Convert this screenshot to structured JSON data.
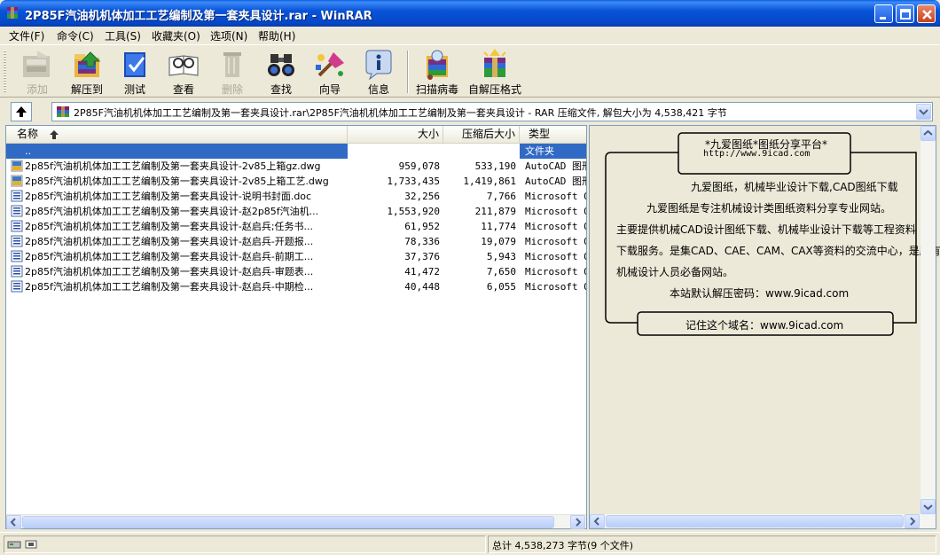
{
  "window": {
    "title": "2P85F汽油机机体加工工艺编制及第一套夹具设计.rar - WinRAR"
  },
  "menu": [
    "文件(F)",
    "命令(C)",
    "工具(S)",
    "收藏夹(O)",
    "选项(N)",
    "帮助(H)"
  ],
  "toolbar": {
    "add": "添加",
    "extract": "解压到",
    "test": "测试",
    "view": "查看",
    "delete": "删除",
    "find": "查找",
    "wizard": "向导",
    "info": "信息",
    "scan": "扫描病毒",
    "sfx": "自解压格式"
  },
  "address": {
    "path": "2P85F汽油机机体加工工艺编制及第一套夹具设计.rar\\2P85F汽油机机体加工工艺编制及第一套夹具设计 - RAR 压缩文件, 解包大小为 4,538,421 字节"
  },
  "columns": {
    "name": "名称",
    "size": "大小",
    "packed": "压缩后大小",
    "type": "类型"
  },
  "files": [
    {
      "name": "..",
      "size": "",
      "packed": "",
      "type": "文件夹",
      "icon": "folder-icon"
    },
    {
      "name": "2p85f汽油机机体加工工艺编制及第一套夹具设计-2v85上箱gz.dwg",
      "size": "959,078",
      "packed": "533,190",
      "type": "AutoCAD 图形",
      "icon": "dwg-file-icon"
    },
    {
      "name": "2p85f汽油机机体加工工艺编制及第一套夹具设计-2v85上箱工艺.dwg",
      "size": "1,733,435",
      "packed": "1,419,861",
      "type": "AutoCAD 图形",
      "icon": "dwg-file-icon"
    },
    {
      "name": "2p85f汽油机机体加工工艺编制及第一套夹具设计-说明书封面.doc",
      "size": "32,256",
      "packed": "7,766",
      "type": "Microsoft Office",
      "icon": "doc-file-icon"
    },
    {
      "name": "2p85f汽油机机体加工工艺编制及第一套夹具设计-赵2p85f汽油机...",
      "size": "1,553,920",
      "packed": "211,879",
      "type": "Microsoft Office",
      "icon": "doc-file-icon"
    },
    {
      "name": "2p85f汽油机机体加工工艺编制及第一套夹具设计-赵启兵;任务书...",
      "size": "61,952",
      "packed": "11,774",
      "type": "Microsoft Office",
      "icon": "doc-file-icon"
    },
    {
      "name": "2p85f汽油机机体加工工艺编制及第一套夹具设计-赵启兵-开题报...",
      "size": "78,336",
      "packed": "19,079",
      "type": "Microsoft Office",
      "icon": "doc-file-icon"
    },
    {
      "name": "2p85f汽油机机体加工工艺编制及第一套夹具设计-赵启兵-前期工...",
      "size": "37,376",
      "packed": "5,943",
      "type": "Microsoft Office",
      "icon": "doc-file-icon"
    },
    {
      "name": "2p85f汽油机机体加工工艺编制及第一套夹具设计-赵启兵-审题表...",
      "size": "41,472",
      "packed": "7,650",
      "type": "Microsoft Office",
      "icon": "doc-file-icon"
    },
    {
      "name": "2p85f汽油机机体加工工艺编制及第一套夹具设计-赵启兵-中期检...",
      "size": "40,448",
      "packed": "6,055",
      "type": "Microsoft Office",
      "icon": "doc-file-icon"
    }
  ],
  "comment": {
    "header_title": "*九爱图纸*图纸分享平台*",
    "header_url": "http://www.9icad.com",
    "line1": "九爱图纸，机械毕业设计下载,CAD图纸下载",
    "line2": "九爱图纸是专注机械设计类图纸资料分享专业网站。",
    "line3": "主要提供机械CAD设计图纸下载、机械毕业设计下载等工程资料",
    "line4": "下载服务。是集CAD、CAE、CAM、CAX等资料的交流中心，是所有",
    "line5": "机械设计人员必备网站。",
    "line6": "本站默认解压密码：www.9icad.com",
    "footer": "记住这个域名：www.9icad.com"
  },
  "status": {
    "summary": "总计 4,538,273 字节(9 个文件)"
  },
  "colors": {
    "selection": "#316ac5",
    "titlebar": "#0854d8"
  }
}
